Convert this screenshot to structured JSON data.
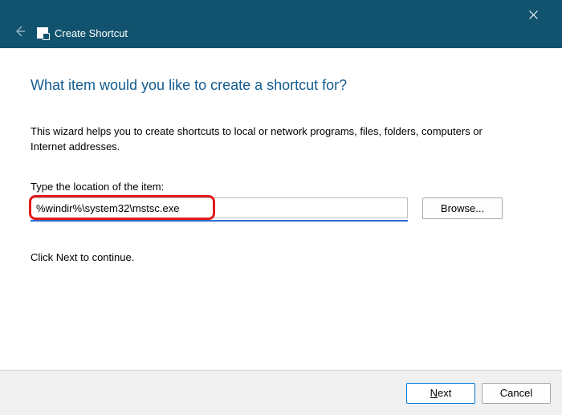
{
  "titlebar": {
    "title": "Create Shortcut"
  },
  "main": {
    "heading": "What item would you like to create a shortcut for?",
    "description": "This wizard helps you to create shortcuts to local or network programs, files, folders, computers or Internet addresses.",
    "location_label": "Type the location of the item:",
    "location_value": "%windir%\\system32\\mstsc.exe",
    "browse_label": "Browse...",
    "continue_text": "Click Next to continue."
  },
  "footer": {
    "next_prefix": "N",
    "next_suffix": "ext",
    "cancel_label": "Cancel"
  },
  "colors": {
    "titlebar_bg": "#11536e",
    "heading_color": "#145c8f",
    "highlight_border": "#e11b1b",
    "accent_blue": "#0078d7"
  }
}
